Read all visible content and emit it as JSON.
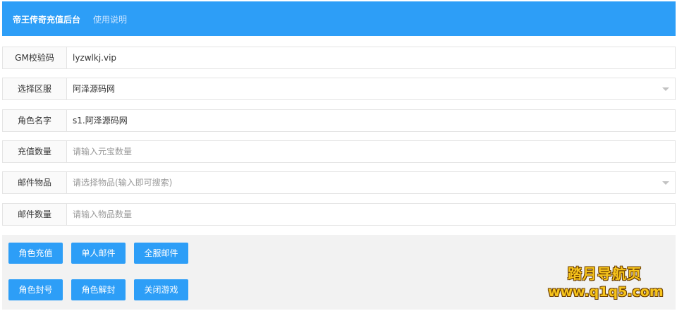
{
  "header": {
    "brand": "帝王传奇充值后台",
    "help_link": "使用说明"
  },
  "form": {
    "gm_code": {
      "label": "GM校验码",
      "value": "lyzwlkj.vip"
    },
    "server": {
      "label": "选择区服",
      "value": "阿泽源码网"
    },
    "role_name": {
      "label": "角色名字",
      "value": "s1.阿泽源码网"
    },
    "recharge_amount": {
      "label": "充值数量",
      "placeholder": "请输入元宝数量"
    },
    "mail_item": {
      "label": "邮件物品",
      "placeholder": "请选择物品(输入即可搜索)"
    },
    "mail_count": {
      "label": "邮件数量",
      "placeholder": "请输入物品数量"
    }
  },
  "buttons": {
    "role_recharge": "角色充值",
    "single_mail": "单人邮件",
    "all_server_mail": "全服邮件",
    "role_ban": "角色封号",
    "role_unban": "角色解封",
    "close_game": "关闭游戏"
  },
  "watermark": {
    "line1": "踏月导航页",
    "line2": "www.q1q5.com"
  },
  "colors": {
    "primary": "#2d9ef7",
    "watermark": "#f7c41b"
  }
}
